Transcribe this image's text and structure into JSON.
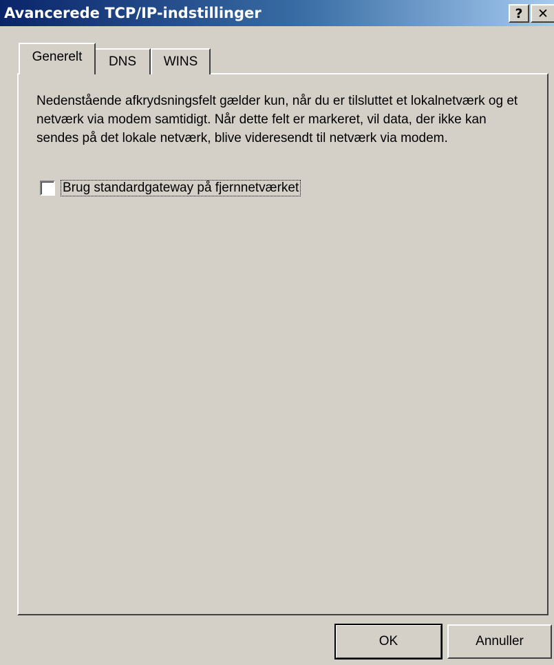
{
  "window": {
    "title": "Avancerede TCP/IP-indstillinger",
    "help_label": "?",
    "close_label": "✕"
  },
  "tabs": [
    {
      "label": "Generelt",
      "active": true
    },
    {
      "label": "DNS",
      "active": false
    },
    {
      "label": "WINS",
      "active": false
    }
  ],
  "general": {
    "description": "Nedenstående afkrydsningsfelt gælder kun, når du er tilsluttet et lokalnetværk og et netværk via modem samtidigt. Når dette felt er markeret, vil data, der ikke kan sendes på det lokale netværk, blive videresendt til netværk via modem.",
    "checkbox_label": "Brug standardgateway på fjernnetværket",
    "checkbox_checked": false
  },
  "buttons": {
    "ok_label": "OK",
    "cancel_label": "Annuller"
  }
}
